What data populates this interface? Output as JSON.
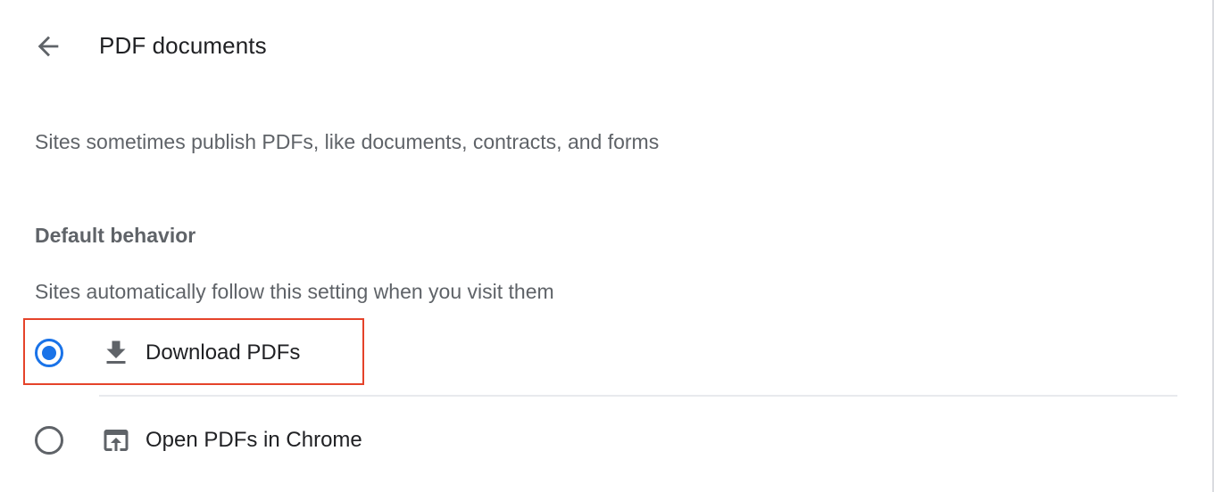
{
  "header": {
    "title": "PDF documents",
    "back_icon": "arrow-back-icon"
  },
  "description": "Sites sometimes publish PDFs, like documents, contracts, and forms",
  "default_behavior": {
    "heading": "Default behavior",
    "subtext": "Sites automatically follow this setting when you visit them",
    "options": [
      {
        "label": "Download PDFs",
        "icon": "download-icon",
        "selected": true
      },
      {
        "label": "Open PDFs in Chrome",
        "icon": "open-in-browser-icon",
        "selected": false
      }
    ]
  },
  "colors": {
    "accent": "#1a73e8",
    "highlight": "#e5432a",
    "text_primary": "#202124",
    "text_secondary": "#5f6368"
  }
}
